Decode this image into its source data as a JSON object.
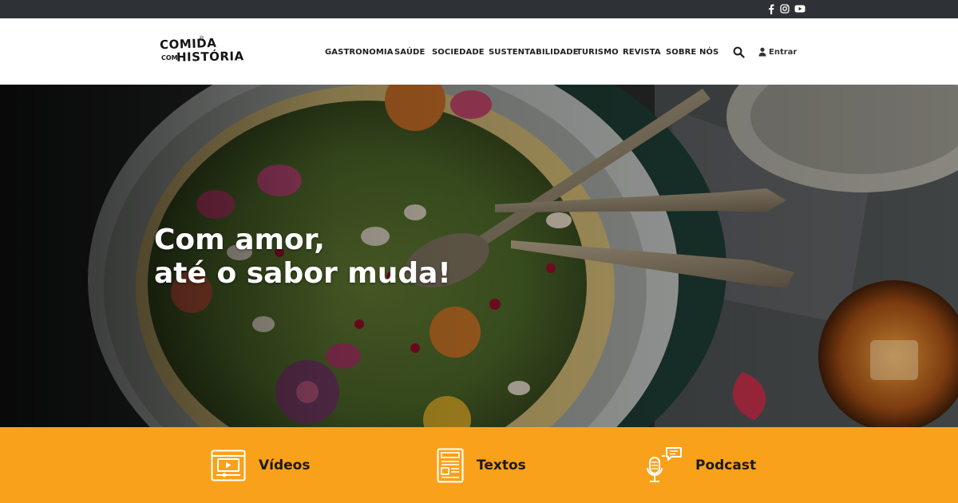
{
  "topbar": {
    "social": [
      {
        "name": "facebook-icon"
      },
      {
        "name": "instagram-icon"
      },
      {
        "name": "youtube-icon"
      }
    ],
    "background": "#2e3236"
  },
  "header": {
    "logo": {
      "line1": "COMIDA",
      "mark": "®",
      "small": "COM",
      "line2": "HISTÓRIA"
    },
    "nav": [
      {
        "label": "GASTRONOMIA"
      },
      {
        "label": "SAÚDE"
      },
      {
        "label": "SOCIEDADE"
      },
      {
        "label": "SUSTENTABILIDADE"
      },
      {
        "label": "TURISMO"
      },
      {
        "label": "REVISTA"
      },
      {
        "label": "SOBRE NÓS"
      }
    ],
    "search_icon": "search-icon",
    "login_label": "Entrar"
  },
  "hero": {
    "title_line1": "Com amor,",
    "title_line2": "até o sabor muda!"
  },
  "categories": {
    "background": "#f9a11b",
    "items": [
      {
        "label": "Vídeos",
        "icon": "video-player-icon"
      },
      {
        "label": "Textos",
        "icon": "document-icon"
      },
      {
        "label": "Podcast",
        "icon": "microphone-icon"
      }
    ]
  }
}
